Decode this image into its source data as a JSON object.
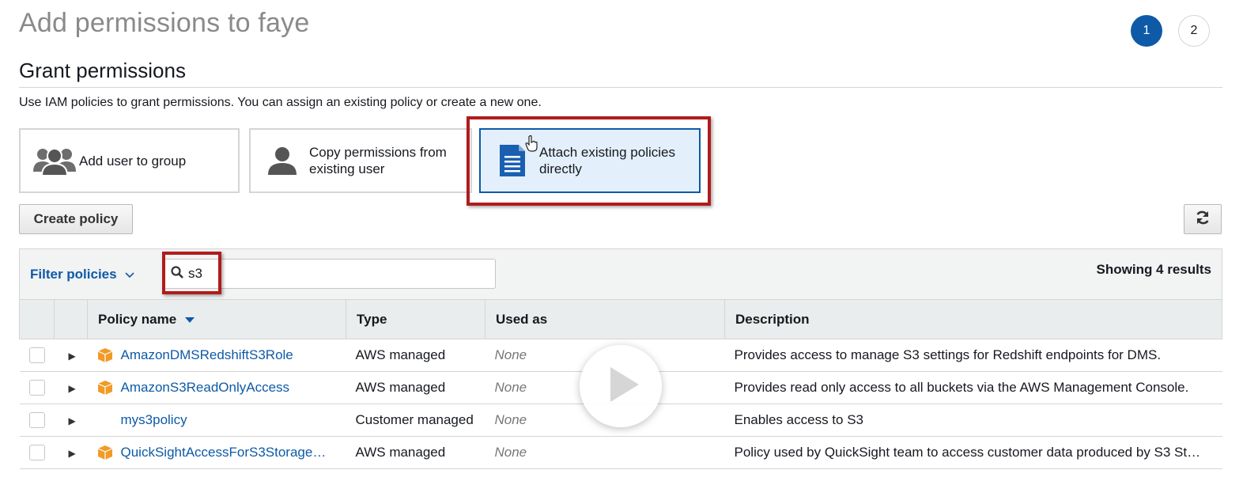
{
  "page": {
    "title": "Add permissions to faye",
    "steps": [
      "1",
      "2"
    ]
  },
  "grant": {
    "title": "Grant permissions",
    "help": "Use IAM policies to grant permissions. You can assign an existing policy or create a new one.",
    "options": [
      {
        "label": "Add user to group",
        "icon": "group-icon"
      },
      {
        "label": "Copy permissions from existing user",
        "icon": "user-icon"
      },
      {
        "label": "Attach existing policies directly",
        "icon": "document-icon",
        "selected": true
      }
    ]
  },
  "toolbar": {
    "create_policy_label": "Create policy",
    "refresh_icon": "refresh-icon"
  },
  "filter": {
    "label": "Filter policies",
    "search_value": "s3",
    "results_text": "Showing 4 results"
  },
  "table": {
    "columns": [
      "Policy name",
      "Type",
      "Used as",
      "Description"
    ],
    "rows": [
      {
        "name": "AmazonDMSRedshiftS3Role",
        "type": "AWS managed",
        "used_as": "None",
        "description": "Provides access to manage S3 settings for Redshift endpoints for DMS.",
        "aws_icon": true
      },
      {
        "name": "AmazonS3ReadOnlyAccess",
        "type": "AWS managed",
        "used_as": "None",
        "description": "Provides read only access to all buckets via the AWS Management Console.",
        "aws_icon": true
      },
      {
        "name": "mys3policy",
        "type": "Customer managed",
        "used_as": "None",
        "description": "Enables access to S3",
        "aws_icon": false
      },
      {
        "name": "QuickSightAccessForS3Storage…",
        "type": "AWS managed",
        "used_as": "None",
        "description": "Policy used by QuickSight team to access customer data produced by S3 St…",
        "aws_icon": true
      }
    ]
  },
  "colors": {
    "link": "#0e5aa7",
    "highlight": "#b01c1c",
    "aws_icon": "#f19b26",
    "selected_bg": "#e3f0fb"
  }
}
